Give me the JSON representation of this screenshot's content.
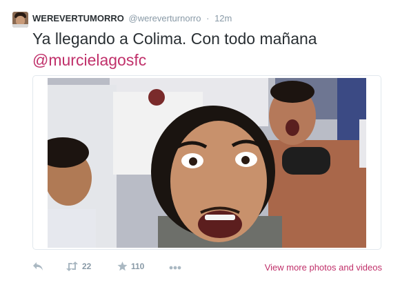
{
  "tweet": {
    "fullname": "WEREVERTUMORRO",
    "handle": "@wereverturnorro",
    "separator": "·",
    "time": "12m",
    "text": "Ya llegando a Colima. Con todo mañana",
    "mention": "@murcielagosfc"
  },
  "actions": {
    "reply_icon": "reply-icon",
    "retweet_icon": "retweet-icon",
    "retweet_count": "22",
    "favorite_icon": "star-icon",
    "favorite_count": "110",
    "more_icon": "more-dots-icon"
  },
  "media_link": "View more photos and videos",
  "colors": {
    "link": "#c0306a",
    "name": "#292f33",
    "meta": "#8899a6",
    "icon": "#aab8c2"
  }
}
